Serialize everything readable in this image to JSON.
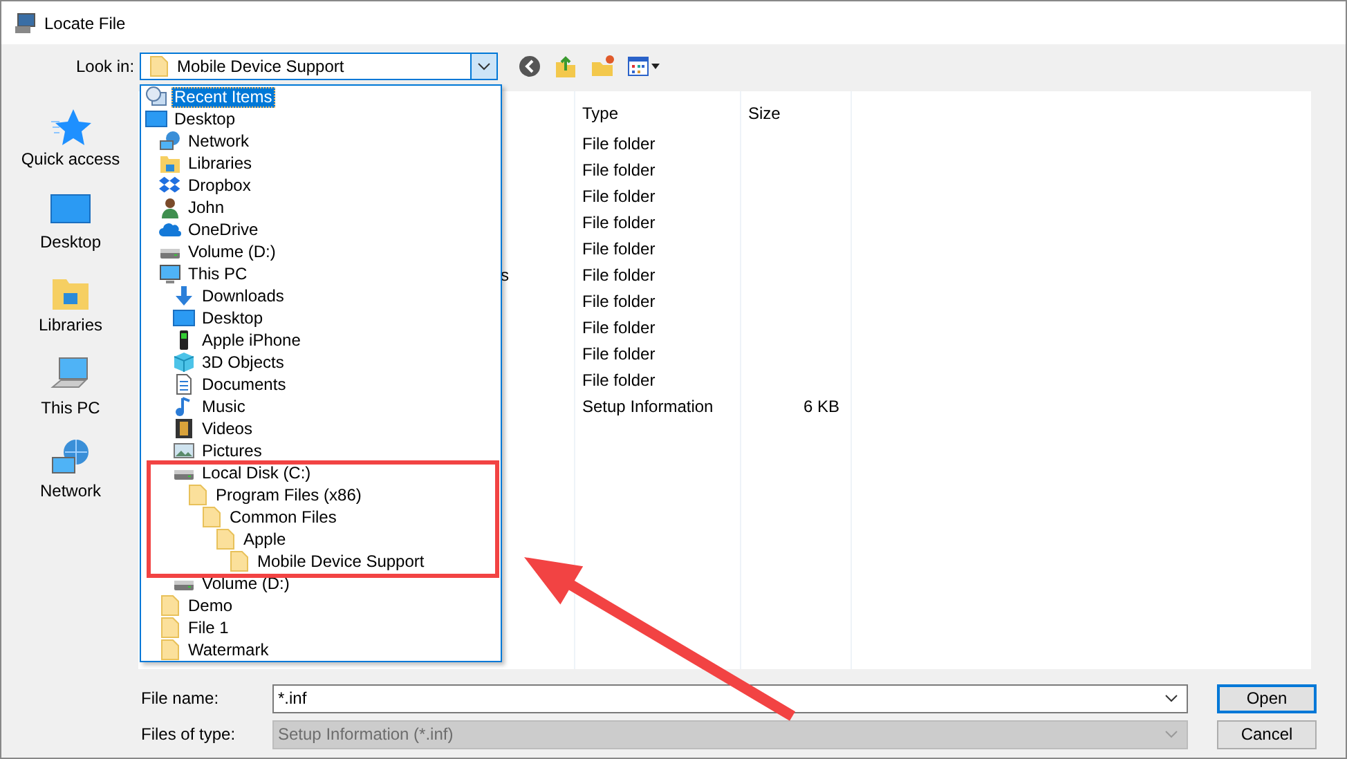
{
  "window": {
    "title": "Locate File"
  },
  "look_in": {
    "label": "Look in:",
    "value": "Mobile Device Support"
  },
  "places": [
    {
      "label": "Quick access",
      "kind": "star"
    },
    {
      "label": "Desktop",
      "kind": "desktop"
    },
    {
      "label": "Libraries",
      "kind": "libraries"
    },
    {
      "label": "This PC",
      "kind": "pc"
    },
    {
      "label": "Network",
      "kind": "network"
    }
  ],
  "file_list": {
    "columns": [
      "Type",
      "Size"
    ],
    "rows": [
      {
        "type": "File folder"
      },
      {
        "type": "File folder"
      },
      {
        "type": "File folder"
      },
      {
        "type": "File folder"
      },
      {
        "type": "File folder"
      },
      {
        "name": "s",
        "type": "File folder"
      },
      {
        "type": "File folder"
      },
      {
        "type": "File folder"
      },
      {
        "type": "File folder"
      },
      {
        "type": "File folder"
      },
      {
        "type": "Setup Information",
        "size": "6 KB"
      }
    ]
  },
  "dropdown": {
    "items": [
      {
        "label": "Recent Items",
        "kind": "recent",
        "selected": true
      },
      {
        "label": "Desktop",
        "kind": "desktop",
        "selected": false,
        "children": [
          {
            "label": "Network",
            "kind": "network",
            "selected": false
          },
          {
            "label": "Libraries",
            "kind": "libraries",
            "selected": false
          },
          {
            "label": "Dropbox",
            "kind": "dropbox",
            "selected": false
          },
          {
            "label": "John",
            "kind": "user",
            "selected": false
          },
          {
            "label": "OneDrive",
            "kind": "cloud",
            "selected": false
          },
          {
            "label": "Volume (D:)",
            "kind": "drive",
            "selected": false
          },
          {
            "label": "This PC",
            "kind": "pc",
            "selected": false,
            "children": [
              {
                "label": "Downloads",
                "kind": "downloads",
                "selected": false
              },
              {
                "label": "Desktop",
                "kind": "desktop",
                "selected": false
              },
              {
                "label": "Apple iPhone",
                "kind": "phone",
                "selected": false
              },
              {
                "label": "3D Objects",
                "kind": "cube",
                "selected": false
              },
              {
                "label": "Documents",
                "kind": "document",
                "selected": false
              },
              {
                "label": "Music",
                "kind": "music",
                "selected": false
              },
              {
                "label": "Videos",
                "kind": "video",
                "selected": false
              },
              {
                "label": "Pictures",
                "kind": "picture",
                "selected": false
              },
              {
                "label": "Local Disk (C:)",
                "kind": "drive",
                "selected": false,
                "children": [
                  {
                    "label": "Program Files (x86)",
                    "kind": "folder",
                    "selected": false,
                    "children": [
                      {
                        "label": "Common Files",
                        "kind": "folder",
                        "selected": false,
                        "children": [
                          {
                            "label": "Apple",
                            "kind": "folder",
                            "selected": false,
                            "children": [
                              {
                                "label": "Mobile Device Support",
                                "kind": "folder",
                                "selected": false
                              }
                            ]
                          }
                        ]
                      }
                    ]
                  }
                ]
              },
              {
                "label": "Volume (D:)",
                "kind": "drive",
                "selected": false
              }
            ]
          },
          {
            "label": "Demo",
            "kind": "folder",
            "selected": false
          },
          {
            "label": "File 1",
            "kind": "folder",
            "selected": false
          },
          {
            "label": "Watermark",
            "kind": "folder",
            "selected": false
          }
        ]
      }
    ]
  },
  "file_name": {
    "label": "File name:",
    "value": "*.inf"
  },
  "file_type": {
    "label": "Files of type:",
    "value": "Setup Information (*.inf)",
    "disabled": true
  },
  "buttons": [
    {
      "label": "Open",
      "default": true
    },
    {
      "label": "Cancel",
      "default": false
    }
  ]
}
